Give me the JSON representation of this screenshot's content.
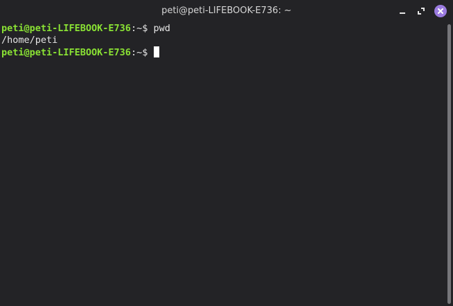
{
  "window": {
    "title": "peti@peti-LIFEBOOK-E736: ~"
  },
  "terminal": {
    "lines": [
      {
        "user_host": "peti@peti-LIFEBOOK-E736",
        "path": ":~$ ",
        "command": "pwd"
      },
      {
        "output": "/home/peti"
      },
      {
        "user_host": "peti@peti-LIFEBOOK-E736",
        "path": ":~$ ",
        "command": ""
      }
    ]
  },
  "icons": {
    "minimize": "minimize-icon",
    "maximize": "maximize-icon",
    "close": "close-icon"
  },
  "colors": {
    "background": "#232326",
    "prompt_user": "#8ae234",
    "text": "#e6e6e6",
    "close_button": "#9b7be0"
  }
}
